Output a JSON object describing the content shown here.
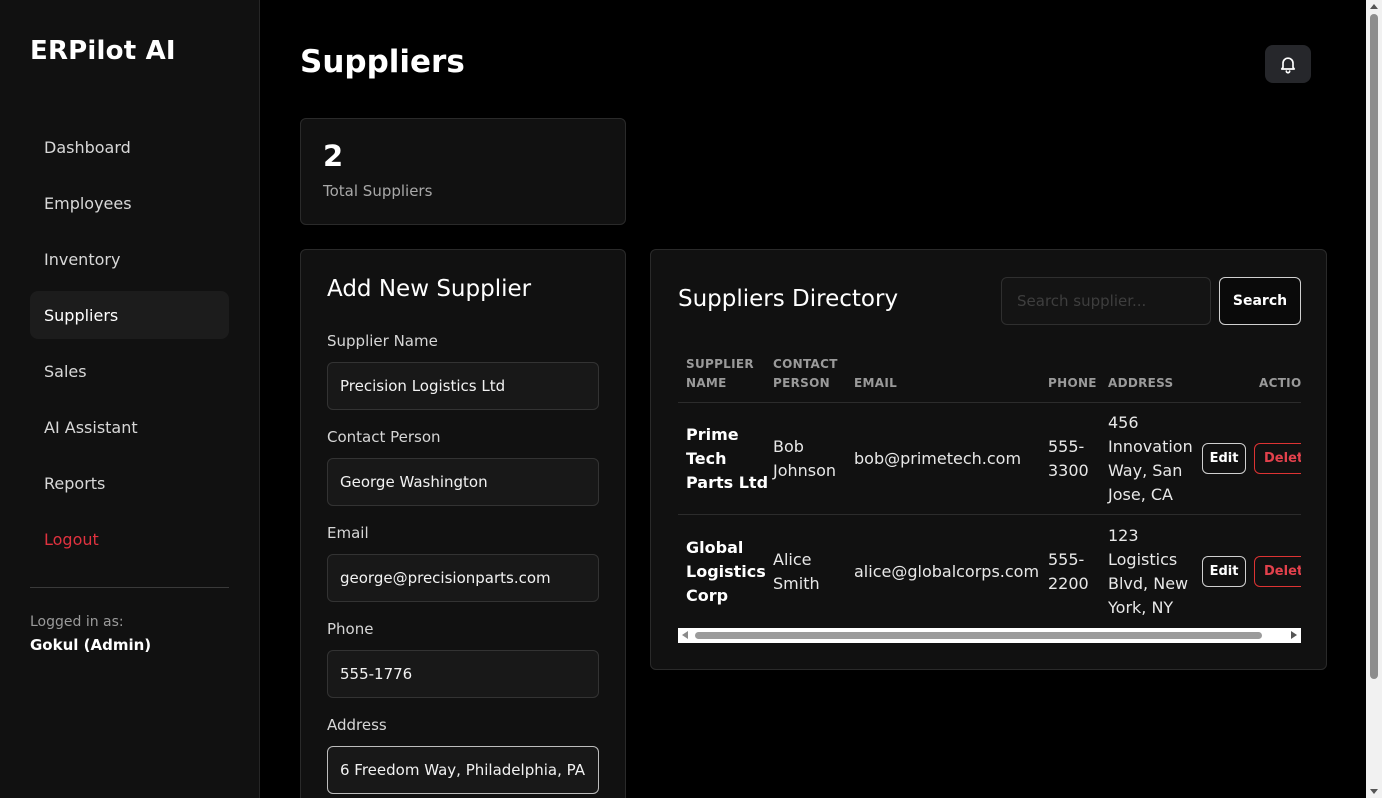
{
  "app": {
    "brand": "ERPilot AI"
  },
  "sidebar": {
    "items": [
      {
        "label": "Dashboard"
      },
      {
        "label": "Employees"
      },
      {
        "label": "Inventory"
      },
      {
        "label": "Suppliers"
      },
      {
        "label": "Sales"
      },
      {
        "label": "AI Assistant"
      },
      {
        "label": "Reports"
      },
      {
        "label": "Logout"
      }
    ],
    "active": "Suppliers",
    "logged_in_label": "Logged in as:",
    "logged_in_user": "Gokul (Admin)"
  },
  "header": {
    "title": "Suppliers",
    "bell_icon": "bell-icon"
  },
  "stats": {
    "total_value": "2",
    "total_label": "Total Suppliers"
  },
  "form": {
    "title": "Add New Supplier",
    "fields": [
      {
        "label": "Supplier Name",
        "value": "Precision Logistics Ltd"
      },
      {
        "label": "Contact Person",
        "value": "George Washington"
      },
      {
        "label": "Email",
        "value": "george@precisionparts.com"
      },
      {
        "label": "Phone",
        "value": "555-1776"
      },
      {
        "label": "Address",
        "value": "6 Freedom Way, Philadelphia, PA"
      }
    ]
  },
  "directory": {
    "title": "Suppliers Directory",
    "search_placeholder": "Search supplier...",
    "search_button": "Search",
    "columns": {
      "name_1": "SUPPLIER",
      "name_2": "NAME",
      "contact_1": "CONTACT",
      "contact_2": "PERSON",
      "email": "EMAIL",
      "phone": "PHONE",
      "address": "ADDRESS",
      "actions": "ACTIONS"
    },
    "rows": [
      {
        "name": [
          "Prime",
          "Tech",
          "Parts Ltd"
        ],
        "contact": [
          "Bob",
          "Johnson"
        ],
        "email": "bob@primetech.com",
        "phone": [
          "555-",
          "3300"
        ],
        "address": [
          "456",
          "Innovation",
          "Way, San",
          "Jose, CA"
        ],
        "edit": "Edit",
        "delete": "Delete"
      },
      {
        "name": [
          "Global",
          "Logistics",
          "Corp"
        ],
        "contact": [
          "Alice",
          "Smith"
        ],
        "email": "alice@globalcorps.com",
        "phone": [
          "555-",
          "2200"
        ],
        "address": [
          "123",
          "Logistics",
          "Blvd, New",
          "York, NY"
        ],
        "edit": "Edit",
        "delete": "Delete"
      }
    ]
  },
  "colors": {
    "background": "#000000",
    "sidebar": "#111111",
    "danger": "#e0323f",
    "card": "#111111"
  }
}
